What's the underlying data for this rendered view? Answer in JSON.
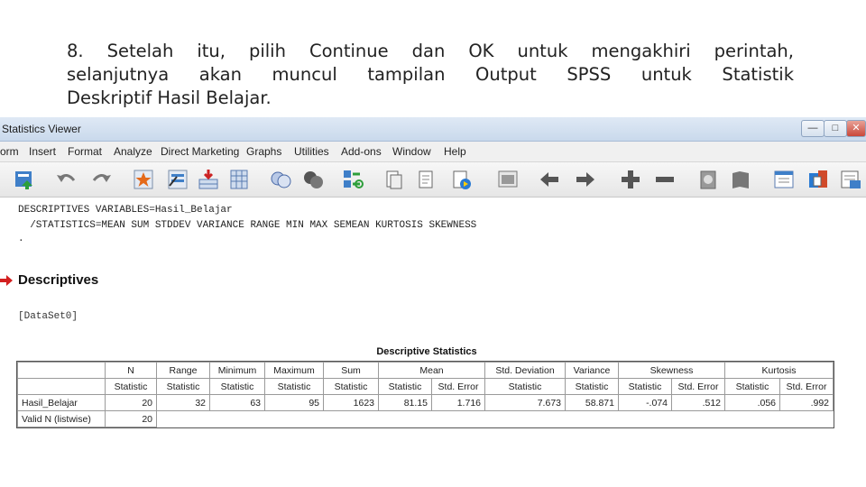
{
  "caption": {
    "line1": "8. Setelah itu, pilih Continue dan OK untuk mengakhiri perintah,",
    "line2": "selanjutnya akan muncul tampilan Output SPSS untuk Statistik",
    "line3": "Deskriptif Hasil Belajar."
  },
  "window": {
    "title": "Statistics Viewer",
    "buttons": {
      "minimize": "—",
      "maximize": "□",
      "close": "✕"
    }
  },
  "menu": [
    "orm",
    "Insert",
    "Format",
    "Analyze",
    "Direct Marketing",
    "Graphs",
    "Utilities",
    "Add-ons",
    "Window",
    "Help"
  ],
  "toolbar_icons": [
    "export-icon",
    "undo-icon",
    "redo-icon",
    "goto-case-icon",
    "goto-variable-icon",
    "insert-case-icon",
    "insert-variable-icon",
    "split-file-icon",
    "select-cases-icon",
    "weight-cases-icon",
    "value-labels-icon",
    "use-sets-icon",
    "show-all-icon",
    "designate-window-icon",
    "promote-icon",
    "demote-icon",
    "expand-icon",
    "collapse-icon",
    "show-icon",
    "hide-icon",
    "insert-heading-icon",
    "insert-title-icon",
    "insert-text-icon",
    "create-script-icon"
  ],
  "syntax": {
    "line1": "DESCRIPTIVES VARIABLES=Hasil_Belajar",
    "line2": "  /STATISTICS=MEAN SUM STDDEV VARIANCE RANGE MIN MAX SEMEAN KURTOSIS SKEWNESS",
    "line3": "."
  },
  "output": {
    "heading": "Descriptives",
    "dataset": "[DataSet0]",
    "table_title": "Descriptive Statistics",
    "headers": {
      "n": "N",
      "range": "Range",
      "minimum": "Minimum",
      "maximum": "Maximum",
      "sum": "Sum",
      "mean": "Mean",
      "std_deviation": "Std. Deviation",
      "variance": "Variance",
      "skewness": "Skewness",
      "kurtosis": "Kurtosis"
    },
    "subheaders": {
      "statistic": "Statistic",
      "std_error": "Std. Error"
    },
    "rows": [
      {
        "label": "Hasil_Belajar",
        "n": "20",
        "range": "32",
        "minimum": "63",
        "maximum": "95",
        "sum": "1623",
        "mean_stat": "81.15",
        "mean_se": "1.716",
        "std_deviation": "7.673",
        "variance": "58.871",
        "skew_stat": "-.074",
        "skew_se": ".512",
        "kurt_stat": ".056",
        "kurt_se": ".992"
      },
      {
        "label": "Valid N (listwise)",
        "n": "20"
      }
    ]
  },
  "colors": {
    "arrow": "#d32020",
    "titlebar": "#c9d9ec"
  }
}
